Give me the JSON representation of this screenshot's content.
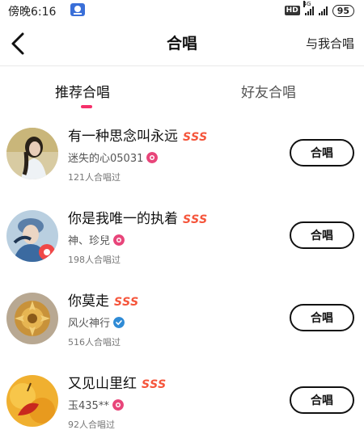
{
  "status_bar": {
    "time": "傍晚6:16",
    "network_badge": "HD",
    "network_type": "4G",
    "battery": "95"
  },
  "header": {
    "title": "合唱",
    "action": "与我合唱",
    "back_icon": "chevron-left-icon"
  },
  "tabs": [
    {
      "label": "推荐合唱",
      "active": true
    },
    {
      "label": "好友合唱",
      "active": false
    }
  ],
  "colors": {
    "accent": "#f5306a",
    "sss": "#f5553b",
    "badge_pink": "#e8457a",
    "badge_blue": "#2f8bd6"
  },
  "list": [
    {
      "song": "有一种思念叫永远",
      "grade": "SSS",
      "singer": "迷失的心05031",
      "badge": "pink",
      "count": "121人合唱过",
      "button": "合唱"
    },
    {
      "song": "你是我唯一的执着",
      "grade": "SSS",
      "singer": "神、珍兒",
      "badge": "pink",
      "count": "198人合唱过",
      "button": "合唱"
    },
    {
      "song": "你莫走",
      "grade": "SSS",
      "singer": "风火神行",
      "badge": "blue",
      "count": "516人合唱过",
      "button": "合唱"
    },
    {
      "song": "又见山里红",
      "grade": "SSS",
      "singer": "玉435**",
      "badge": "pink",
      "count": "92人合唱过",
      "button": "合唱"
    }
  ]
}
